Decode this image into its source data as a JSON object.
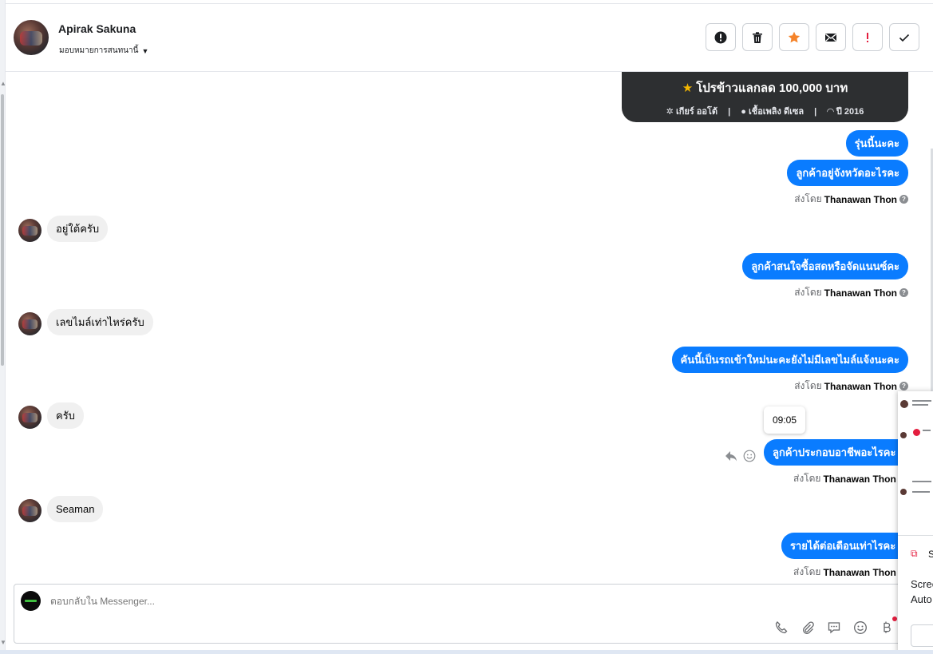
{
  "header": {
    "name": "Apirak Sakuna",
    "assign_label": "มอบหมายการสนทนานี้"
  },
  "actions": {
    "icons": [
      "alert-circle-icon",
      "trash-icon",
      "star-icon",
      "envelope-icon",
      "exclamation-icon",
      "check-icon"
    ],
    "star_color": "#f5832a",
    "exclaim_color": "#e41e3f"
  },
  "card": {
    "title": "โปรข้าวแลกลด 100,000 บาท",
    "spec_gear": "เกียร์ ออโต้",
    "spec_fuel": "เชื้อเพลิง ดีเซล",
    "spec_year": "ปี 2016"
  },
  "messages": {
    "out_1": "รุ่นนี้นะคะ",
    "out_2": "ลูกค้าอยู่จังหวัดอะไรคะ",
    "in_1": "อยู่ใต้ครับ",
    "out_3": "ลูกค้าสนใจซื้อสดหรือจัดแนนซ์คะ",
    "in_2": "เลขไมล์เท่าไหร่ครับ",
    "out_4": "คันนี้เป็นรถเข้าใหม่นะคะยังไม่มีเลขไมล์แจ้งนะคะ",
    "in_3": "ครับ",
    "tooltip_time": "09:05",
    "out_5": "ลูกค้าประกอบอาชีพอะไรคะ",
    "in_4": "Seaman",
    "out_6": "รายได้ต่อเดือนเท่าไรคะ"
  },
  "sender": {
    "prefix": "ส่งโดย",
    "name": "Thanawan Thon"
  },
  "composer": {
    "placeholder": "ตอบกลับใน Messenger...",
    "tools": [
      "phone-icon",
      "paperclip-icon",
      "saved-reply-icon",
      "emoji-icon",
      "baht-icon"
    ]
  },
  "overlay": {
    "s_label": "S",
    "line_1": "Scree",
    "line_2": "Auto"
  },
  "colors": {
    "outgoing_bubble": "#0a7cff",
    "incoming_bubble": "#f0f0f0",
    "card_bg": "#2d2f31"
  }
}
